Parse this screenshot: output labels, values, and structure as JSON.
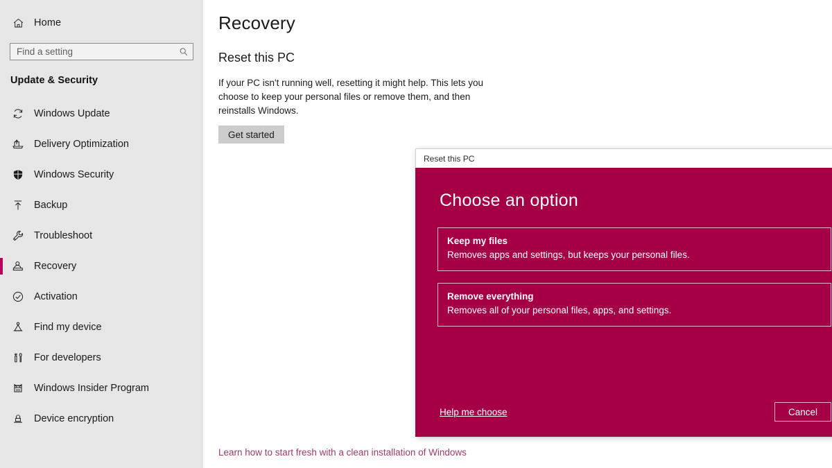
{
  "sidebar": {
    "home": {
      "label": "Home",
      "icon": "home-icon"
    },
    "search": {
      "value": "",
      "placeholder": "Find a setting",
      "icon": "search-icon"
    },
    "section_header": "Update & Security",
    "selected_item": "Recovery",
    "accent_color": "#b4005a",
    "background_color": "#e6e6e6",
    "items": [
      {
        "label": "Windows Update",
        "icon": "refresh-icon"
      },
      {
        "label": "Delivery Optimization",
        "icon": "delivery-icon"
      },
      {
        "label": "Windows Security",
        "icon": "shield-icon"
      },
      {
        "label": "Backup",
        "icon": "upload-arrow-icon"
      },
      {
        "label": "Troubleshoot",
        "icon": "wrench-icon"
      },
      {
        "label": "Recovery",
        "icon": "recovery-icon"
      },
      {
        "label": "Activation",
        "icon": "check-circle-icon"
      },
      {
        "label": "Find my device",
        "icon": "locate-device-icon"
      },
      {
        "label": "For developers",
        "icon": "tools-icon"
      },
      {
        "label": "Windows Insider Program",
        "icon": "insider-ninjacat-icon"
      },
      {
        "label": "Device encryption",
        "icon": "lock-icon"
      }
    ]
  },
  "main": {
    "page_title": "Recovery",
    "section_title": "Reset this PC",
    "description": "If your PC isn't running well, resetting it might help. This lets you choose to keep your personal files or remove them, and then reinstalls Windows.",
    "get_started_label": "Get started",
    "learn_link": "Learn how to start fresh with a clean installation of Windows",
    "learn_link_color": "#9b3b6b"
  },
  "dialog": {
    "titlebar": "Reset this PC",
    "heading": "Choose an option",
    "background_color": "#a50045",
    "border_color": "#e7b8cb",
    "options": [
      {
        "title": "Keep my files",
        "description": "Removes apps and settings, but keeps your personal files."
      },
      {
        "title": "Remove everything",
        "description": "Removes all of your personal files, apps, and settings."
      }
    ],
    "help_link": "Help me choose",
    "cancel_label": "Cancel"
  }
}
